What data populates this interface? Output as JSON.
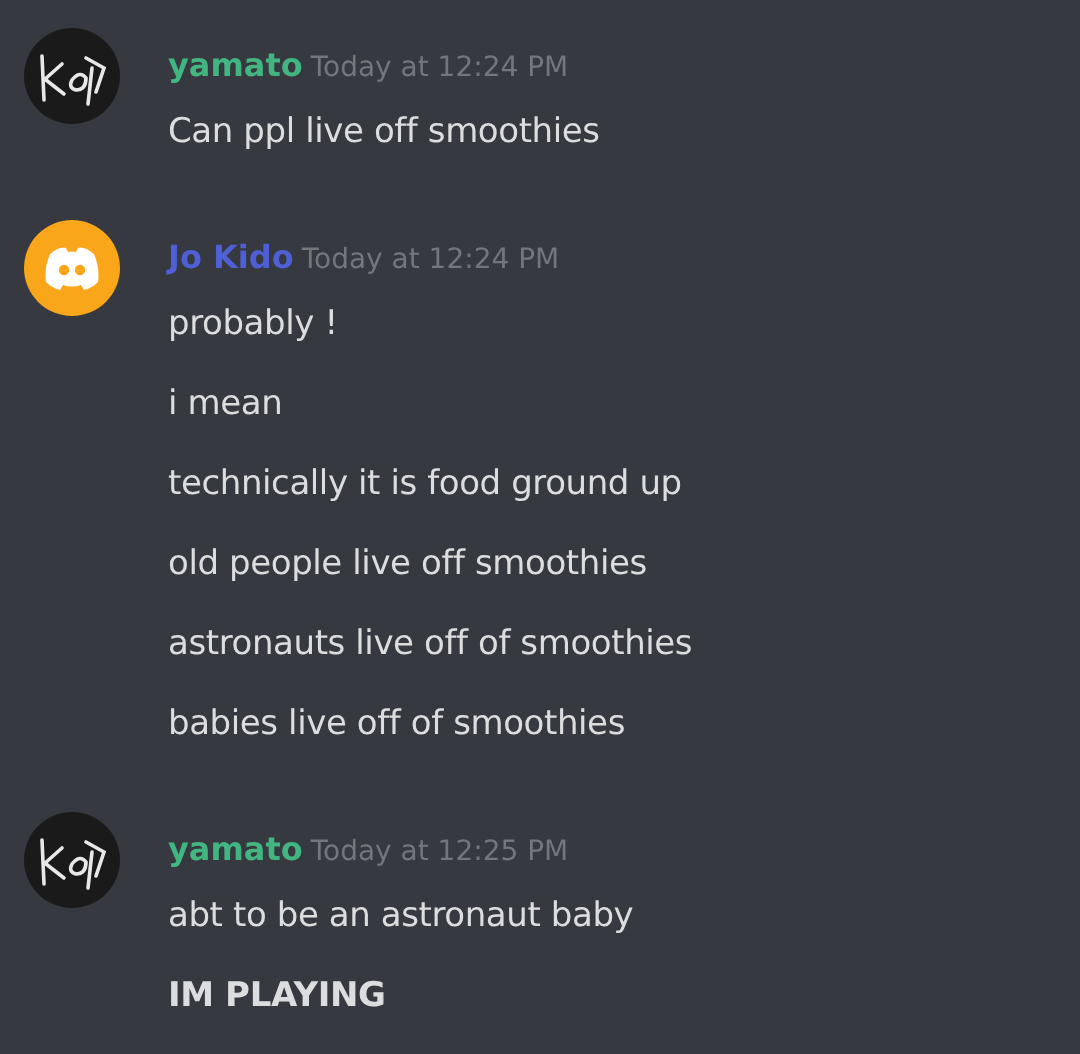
{
  "messages": [
    {
      "author": "yamato",
      "color": "#43b581",
      "avatar": {
        "kind": "kod"
      },
      "timestamp": "Today at 12:24 PM",
      "lines": [
        {
          "text": "Can ppl live off smoothies",
          "bold": false
        }
      ]
    },
    {
      "author": "Jo Kido",
      "color": "#4f5fd6",
      "avatar": {
        "kind": "default"
      },
      "timestamp": "Today at 12:24 PM",
      "lines": [
        {
          "text": "probably !",
          "bold": false
        },
        {
          "text": "i mean",
          "bold": false
        },
        {
          "text": "technically it is food ground up",
          "bold": false
        },
        {
          "text": "old people live off smoothies",
          "bold": false
        },
        {
          "text": "astronauts live off of smoothies",
          "bold": false
        },
        {
          "text": "babies live off of smoothies",
          "bold": false
        }
      ]
    },
    {
      "author": "yamato",
      "color": "#43b581",
      "avatar": {
        "kind": "kod"
      },
      "timestamp": "Today at 12:25 PM",
      "lines": [
        {
          "text": "abt to be an astronaut baby",
          "bold": false
        },
        {
          "text": "IM PLAYING",
          "bold": true
        }
      ]
    }
  ]
}
